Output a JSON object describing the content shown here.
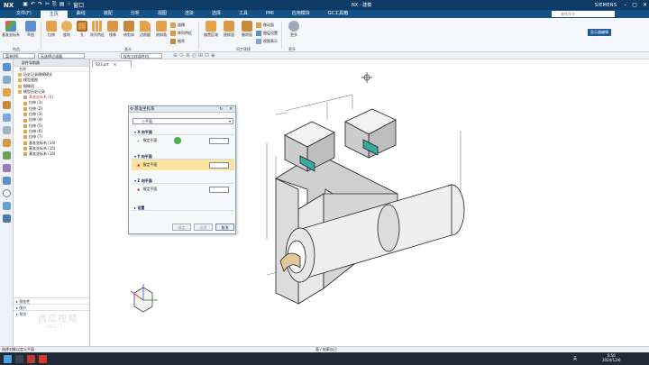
{
  "titlebar": {
    "logo": "NX",
    "window_menu": "窗口",
    "title": "NX - 建模",
    "brand": "SIEMENS"
  },
  "menu": {
    "items": [
      "文件(F)",
      "主页",
      "曲线",
      "装配",
      "分析",
      "视图",
      "渲染",
      "选择",
      "工具",
      "PMI",
      "应用模块",
      "GC工具箱"
    ],
    "active_index": 1,
    "search_placeholder": "查找命令"
  },
  "ribbon": {
    "big_buttons": [
      "基准坐标系",
      "草图",
      "拉伸",
      "旋转",
      "孔",
      "阵列特征",
      "镜像",
      "修剪体",
      "边倒圆",
      "倒斜角",
      "拔模",
      "抽壳"
    ],
    "small_buttons": [
      "拔模",
      "阵列特征",
      "抽壳",
      "偏置区域",
      "替换面",
      "删除面",
      "移动面",
      "图层设置",
      "视图表示",
      "更多",
      "更多"
    ],
    "groups": [
      "构造",
      "基本",
      "同步建模",
      "更多"
    ],
    "right_button": "显示器编辑"
  },
  "toolbar": {
    "menu_label": "菜单(M)",
    "filter": "无选择过滤器",
    "scope": "仅在工作部件内"
  },
  "navigator": {
    "title": "部件导航器",
    "column": "名称",
    "rows": [
      {
        "label": "历史记录建模模式",
        "depth": 1
      },
      {
        "label": "模型视图",
        "depth": 1
      },
      {
        "label": "摄像机",
        "depth": 1
      },
      {
        "label": "模型历史记录",
        "depth": 1
      },
      {
        "label": "基准坐标系 (0)",
        "depth": 2
      },
      {
        "label": "拉伸 (1)",
        "depth": 2
      },
      {
        "label": "拉伸 (2)",
        "depth": 2
      },
      {
        "label": "拉伸 (3)",
        "depth": 2
      },
      {
        "label": "拉伸 (4)",
        "depth": 2
      },
      {
        "label": "拉伸 (5)",
        "depth": 2
      },
      {
        "label": "拉伸 (6)",
        "depth": 2
      },
      {
        "label": "拉伸 (7)",
        "depth": 2
      },
      {
        "label": "基准坐标系 (14)",
        "depth": 2
      },
      {
        "label": "基准坐标系 (15)",
        "depth": 2
      },
      {
        "label": "基准坐标系 (16)",
        "depth": 2
      }
    ],
    "bottom_tabs": [
      "相依性",
      "细节",
      "预览"
    ]
  },
  "file_tab": "S33.prt",
  "dialog": {
    "title": "基准坐标系",
    "type": "三平面",
    "sections": [
      {
        "header": "X 向平面",
        "row_label": "指定平面",
        "highlighted": false
      },
      {
        "header": "Y 向平面",
        "row_label": "指定平面",
        "highlighted": true
      },
      {
        "header": "Z 向平面",
        "row_label": "指定平面",
        "highlighted": false
      },
      {
        "header": "设置",
        "row_label": "",
        "highlighted": false
      }
    ],
    "buttons": [
      "确定",
      "应用",
      "取消"
    ]
  },
  "status": {
    "left": "选择对象以定义平面",
    "center": "面 / 轮廓自己"
  },
  "taskbar": {
    "ime": "英",
    "time": "6:56",
    "date": "2024/12/6"
  },
  "watermark": {
    "text": "西瓜视频",
    "sub": "UG入门"
  },
  "colors": {
    "titlebar": "#0e3a66",
    "menubar": "#145184",
    "highlight": "#fbe3a0",
    "accent": "#f0b848"
  }
}
